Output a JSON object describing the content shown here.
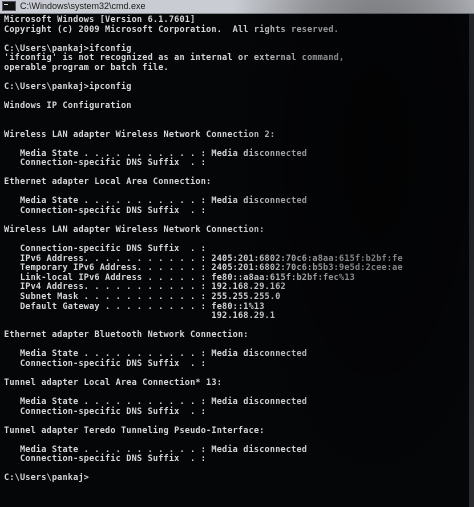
{
  "window": {
    "title": "C:\\Windows\\system32\\cmd.exe",
    "icon": "cmd-icon"
  },
  "console": {
    "lines": [
      "Microsoft Windows [Version 6.1.7601]",
      "Copyright (c) 2009 Microsoft Corporation.  All rights reserved.",
      "",
      "C:\\Users\\pankaj>ifconfig",
      "'ifconfig' is not recognized as an internal or external command,",
      "operable program or batch file.",
      "",
      "C:\\Users\\pankaj>ipconfig",
      "",
      "Windows IP Configuration",
      "",
      "",
      "Wireless LAN adapter Wireless Network Connection 2:",
      "",
      "   Media State . . . . . . . . . . . : Media disconnected",
      "   Connection-specific DNS Suffix  . :",
      "",
      "Ethernet adapter Local Area Connection:",
      "",
      "   Media State . . . . . . . . . . . : Media disconnected",
      "   Connection-specific DNS Suffix  . :",
      "",
      "Wireless LAN adapter Wireless Network Connection:",
      "",
      "   Connection-specific DNS Suffix  . :",
      "   IPv6 Address. . . . . . . . . . . : 2405:201:6802:70c6:a8aa:615f:b2bf:fe",
      "   Temporary IPv6 Address. . . . . . : 2405:201:6802:70c6:b5b3:9e5d:2cee:ae",
      "   Link-local IPv6 Address . . . . . : fe80::a8aa:615f:b2bf:fec%13",
      "   IPv4 Address. . . . . . . . . . . : 192.168.29.162",
      "   Subnet Mask . . . . . . . . . . . : 255.255.255.0",
      "   Default Gateway . . . . . . . . . : fe80::1%13",
      "                                       192.168.29.1",
      "",
      "Ethernet adapter Bluetooth Network Connection:",
      "",
      "   Media State . . . . . . . . . . . : Media disconnected",
      "   Connection-specific DNS Suffix  . :",
      "",
      "Tunnel adapter Local Area Connection* 13:",
      "",
      "   Media State . . . . . . . . . . . : Media disconnected",
      "   Connection-specific DNS Suffix  . :",
      "",
      "Tunnel adapter Teredo Tunneling Pseudo-Interface:",
      "",
      "   Media State . . . . . . . . . . . : Media disconnected",
      "   Connection-specific DNS Suffix  . :",
      "",
      "C:\\Users\\pankaj>"
    ]
  },
  "colors": {
    "background": "#050608",
    "text": "#d6d7da",
    "titlebar": "#c9ccd2"
  }
}
